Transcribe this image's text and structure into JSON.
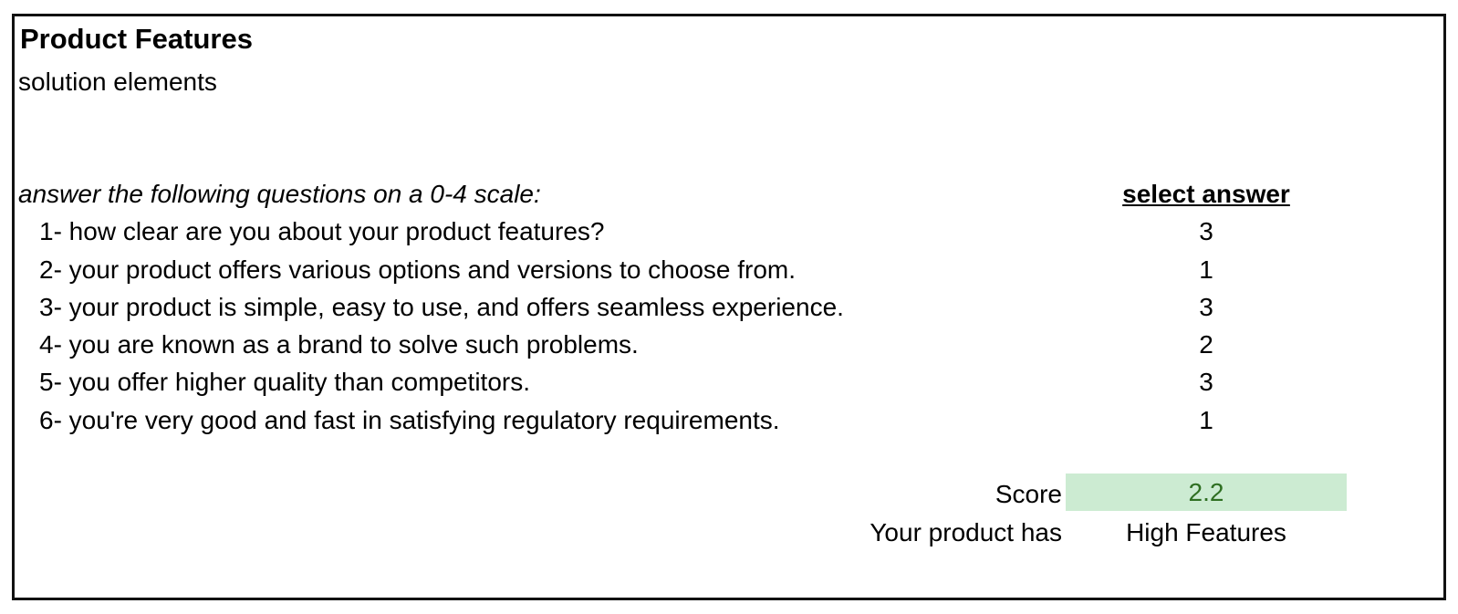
{
  "sheet": {
    "title": "Product Features",
    "subtitle": "solution elements",
    "instructions": "answer the following questions on a 0-4 scale:",
    "answer_header": "select answer"
  },
  "questions": [
    {
      "text": "1- how clear are you about your product features?",
      "answer": "3"
    },
    {
      "text": "2- your product offers various options and versions to choose from.",
      "answer": "1"
    },
    {
      "text": "3- your product is simple, easy to use, and offers seamless experience.",
      "answer": "3"
    },
    {
      "text": "4- you are known as a brand to solve such problems.",
      "answer": "2"
    },
    {
      "text": "5- you offer higher quality than competitors.",
      "answer": "3"
    },
    {
      "text": "6- you're very good and fast in satisfying regulatory requirements.",
      "answer": "1"
    }
  ],
  "summary": {
    "score_label": "Score",
    "score_value": "2.2",
    "result_label": "Your product has",
    "result_value": "High Features"
  },
  "colors": {
    "score_fill": "#ccebd2",
    "score_text": "#2f6f22",
    "border": "#111111"
  }
}
